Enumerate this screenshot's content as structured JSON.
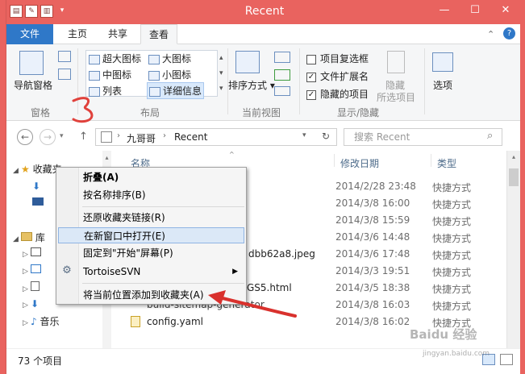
{
  "window": {
    "title": "Recent",
    "controls": {
      "minimize": "—",
      "maximize": "☐",
      "close": "✕"
    },
    "help": "?"
  },
  "tabs": {
    "file": "文件",
    "home": "主页",
    "share": "共享",
    "view": "查看"
  },
  "ribbon": {
    "panes": {
      "nav_pane": "导航窗格",
      "label": "窗格"
    },
    "layout": {
      "xl_icons": "超大图标",
      "l_icons": "大图标",
      "m_icons": "中图标",
      "s_icons": "小图标",
      "list": "列表",
      "details": "详细信息",
      "label": "布局"
    },
    "current_view": {
      "sort": "排序方式",
      "label": "当前视图"
    },
    "show_hide": {
      "item_checkbox": "项目复选框",
      "item_checkbox_checked": false,
      "extensions": "文件扩展名",
      "extensions_checked": true,
      "hidden_items": "隐藏的项目",
      "hidden_items_checked": true,
      "hide_selected": "隐藏",
      "hide_selected_2": "所选项目",
      "label": "显示/隐藏"
    },
    "options": "选项"
  },
  "navbar": {
    "breadcrumb": [
      "九哥哥",
      "Recent"
    ],
    "search_placeholder": "搜索 Recent"
  },
  "annotation_number": "3",
  "columns": {
    "name": "名称",
    "date": "修改日期",
    "type": "类型"
  },
  "rows": [
    {
      "name": "",
      "date": "2014/2/28 23:48",
      "type": "快捷方式"
    },
    {
      "name": "",
      "date": "2014/3/8 16:00",
      "type": "快捷方式"
    },
    {
      "name": "",
      "date": "2014/3/8 15:59",
      "type": "快捷方式"
    },
    {
      "name": "",
      "date": "2014/3/6 14:48",
      "type": "快捷方式"
    },
    {
      "name": "dbb62a8.jpeg",
      "date": "2014/3/6 17:48",
      "type": "快捷方式"
    },
    {
      "name": "",
      "date": "2014/3/3 19:51",
      "type": "快捷方式"
    },
    {
      "name": "GS5.html",
      "date": "2014/3/5 18:38",
      "type": "快捷方式"
    },
    {
      "name": "build-sitemap-generator",
      "date": "2014/3/8 16:03",
      "type": "快捷方式"
    },
    {
      "name": "config.yaml",
      "date": "2014/3/8 16:02",
      "type": "快捷方式"
    }
  ],
  "nav_tree": {
    "favorites": "收藏夹",
    "library": "库",
    "music": "音乐"
  },
  "context_menu": {
    "collapse": "折叠(A)",
    "sort_by_name": "按名称排序(B)",
    "restore_links": "还原收藏夹链接(R)",
    "open_new_window": "在新窗口中打开(E)",
    "pin_start": "固定到\"开始\"屏幕(P)",
    "tortoise": "TortoiseSVN",
    "add_current": "将当前位置添加到收藏夹(A)"
  },
  "status": {
    "count": "73 个项目"
  },
  "watermark": {
    "brand": "Baidu 经验",
    "url": "jingyan.baidu.com"
  }
}
